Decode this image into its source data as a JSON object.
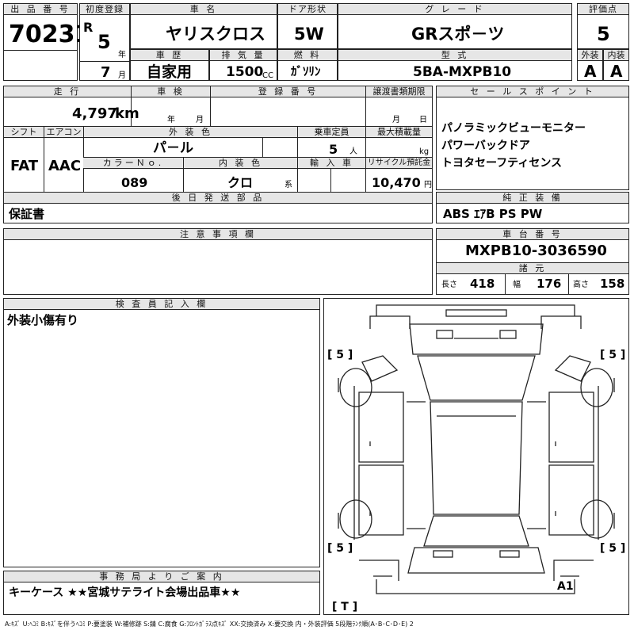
{
  "header": {
    "lot_no_label": "出 品 番 号",
    "lot_no": "70231",
    "first_reg_label": "初度登録",
    "era": "R",
    "year": "5",
    "year_unit": "年",
    "month": "7",
    "month_unit": "月",
    "car_name_label": "車 名",
    "car_name": "ヤリスクロス",
    "door_label": "ドア形状",
    "door": "5W",
    "grade_label": "グ レ ー ド",
    "grade": "GRスポ－ツ",
    "score_label": "評価点",
    "score": "5",
    "history_label": "車 歴",
    "history": "自家用",
    "displacement_label": "排 気 量",
    "displacement": "1500",
    "displacement_unit": "CC",
    "fuel_label": "燃 料",
    "fuel": "ｶﾞｿﾘﾝ",
    "model_label": "型 式",
    "model": "5BA-MXPB10",
    "ext_label": "外装",
    "ext": "A",
    "int_label": "内装",
    "int": "A"
  },
  "mid": {
    "mileage_label": "走 行",
    "mileage": "4,797",
    "mileage_unit": "km",
    "inspection_label": "車 検",
    "insp_year_unit": "年",
    "insp_month_unit": "月",
    "reg_no_label": "登 録 番 号",
    "transfer_label": "譲渡書類期限",
    "transfer_month_unit": "月",
    "transfer_day_unit": "日",
    "shift_label": "シフト",
    "shift": "FAT",
    "ac_label": "エアコン",
    "ac": "AAC",
    "ext_color_label": "外 装 色",
    "ext_color": "パ－ル",
    "capacity_label": "乗車定員",
    "capacity": "5",
    "capacity_unit": "人",
    "max_load_label": "最大積載量",
    "max_load_unit": "kg",
    "color_no_label": "カラーＮｏ.",
    "color_no": "089",
    "int_color_label": "内 装 色",
    "int_color": "クロ",
    "int_color_unit": "系",
    "import_label": "輸 入 車",
    "recycle_label": "リサイクル預託金",
    "recycle": "10,470",
    "recycle_unit": "円",
    "later_parts_label": "後 日 発 送 部 品",
    "later_parts": "保証書"
  },
  "sales": {
    "label": "セ ー ル ス ポ イ ン ト",
    "points": [
      "パノラミックビューモニター",
      "パワーバックドア",
      "トヨタセーフティセンス"
    ]
  },
  "equipment": {
    "label": "純 正 装 備",
    "value": "ABS ｴｱB PS PW"
  },
  "notes": {
    "label": "注 意 事 項 欄"
  },
  "chassis": {
    "label": "車 台 番 号",
    "value": "MXPB10-3036590",
    "spec_label": "諸 元",
    "length_label": "長さ",
    "length": "418",
    "width_label": "幅",
    "width": "176",
    "height_label": "高さ",
    "height": "158"
  },
  "inspector": {
    "label": "検 査 員 記 入 欄",
    "text": "外装小傷有り"
  },
  "diagram": {
    "tl": "[ 5 ]",
    "tr": "[ 5 ]",
    "bl": "[ 5 ]",
    "br": "[ 5 ]",
    "mark": "A1",
    "t_mark": "[ T ]"
  },
  "office": {
    "label": "事 務 局 よ り ご 案 内",
    "text": "キーケース ★★宮城サテライト会場出品車★★"
  },
  "legend": "A:ｷｽﾞ U:ﾍｺﾐ B:ｷｽﾞを伴うﾍｺﾐ P:要塗装 W:補修跡 S:錆 C:腐食 G:ﾌﾛﾝﾄｶﾞﾗｽ点ｷｽﾞ XX:交換済み X:要交換 内・外装評価 5段階ﾗﾝｸ順(A･B･C･D･E) 2"
}
